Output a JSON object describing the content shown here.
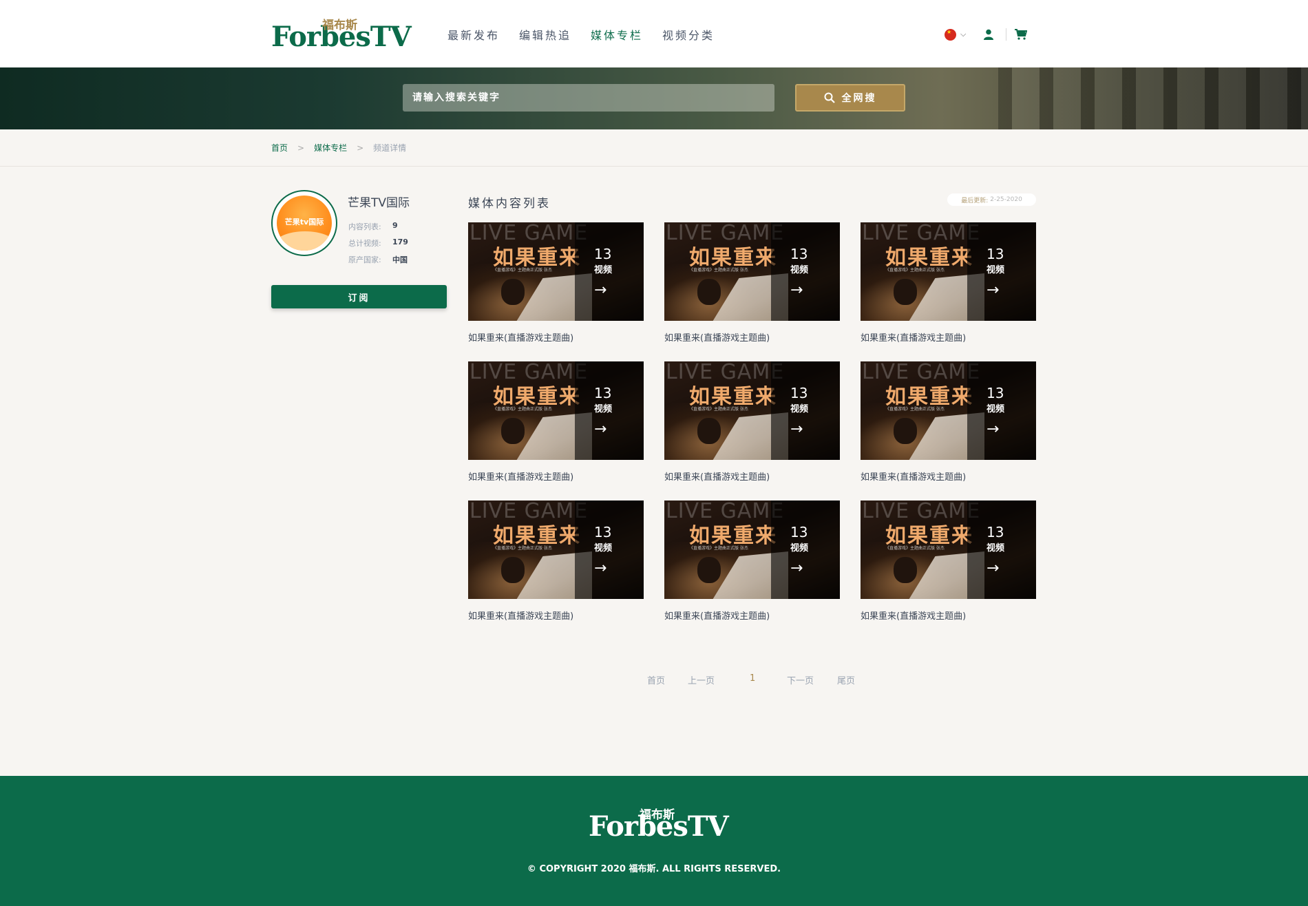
{
  "header": {
    "logo_en": "ForbesTV",
    "logo_cn": "福布斯",
    "nav": [
      {
        "label": "最新发布",
        "active": false
      },
      {
        "label": "编辑热追",
        "active": false
      },
      {
        "label": "媒体专栏",
        "active": true
      },
      {
        "label": "视频分类",
        "active": false
      }
    ],
    "icons": [
      "china-flag-icon",
      "chevron-down-icon",
      "user-icon",
      "cart-icon"
    ]
  },
  "search": {
    "placeholder": "请输入搜索关键字",
    "button_label": "全网搜"
  },
  "breadcrumb": {
    "home": "首页",
    "section": "媒体专栏",
    "current": "频道详情",
    "sep": ">"
  },
  "channel": {
    "name": "芒果TV国际",
    "avatar_text": "芒果tv国际",
    "meta": [
      {
        "key": "内容列表:",
        "value": "9"
      },
      {
        "key": "总计视频:",
        "value": "179"
      },
      {
        "key": "原产国家:",
        "value": "中国"
      }
    ],
    "subscribe_label": "订阅"
  },
  "content": {
    "title": "媒体内容列表",
    "updated_label": "最后更新:",
    "updated_value": "2-25-2020",
    "cards": [
      {
        "title": "如果重来(直播游戏主题曲)",
        "thumb_heading": "如果重来",
        "thumb_bg_text": "LIVE GAME",
        "thumb_sub": "《直播游戏》主题曲正式版   张杰",
        "count": "13",
        "count_label": "视频"
      },
      {
        "title": "如果重来(直播游戏主题曲)",
        "thumb_heading": "如果重来",
        "thumb_bg_text": "LIVE GAME",
        "thumb_sub": "《直播游戏》主题曲正式版   张杰",
        "count": "13",
        "count_label": "视频"
      },
      {
        "title": "如果重来(直播游戏主题曲)",
        "thumb_heading": "如果重来",
        "thumb_bg_text": "LIVE GAME",
        "thumb_sub": "《直播游戏》主题曲正式版   张杰",
        "count": "13",
        "count_label": "视频"
      },
      {
        "title": "如果重来(直播游戏主题曲)",
        "thumb_heading": "如果重来",
        "thumb_bg_text": "LIVE GAME",
        "thumb_sub": "《直播游戏》主题曲正式版   张杰",
        "count": "13",
        "count_label": "视频"
      },
      {
        "title": "如果重来(直播游戏主题曲)",
        "thumb_heading": "如果重来",
        "thumb_bg_text": "LIVE GAME",
        "thumb_sub": "《直播游戏》主题曲正式版   张杰",
        "count": "13",
        "count_label": "视频"
      },
      {
        "title": "如果重来(直播游戏主题曲)",
        "thumb_heading": "如果重来",
        "thumb_bg_text": "LIVE GAME",
        "thumb_sub": "《直播游戏》主题曲正式版   张杰",
        "count": "13",
        "count_label": "视频"
      },
      {
        "title": "如果重来(直播游戏主题曲)",
        "thumb_heading": "如果重来",
        "thumb_bg_text": "LIVE GAME",
        "thumb_sub": "《直播游戏》主题曲正式版   张杰",
        "count": "13",
        "count_label": "视频"
      },
      {
        "title": "如果重来(直播游戏主题曲)",
        "thumb_heading": "如果重来",
        "thumb_bg_text": "LIVE GAME",
        "thumb_sub": "《直播游戏》主题曲正式版   张杰",
        "count": "13",
        "count_label": "视频"
      },
      {
        "title": "如果重来(直播游戏主题曲)",
        "thumb_heading": "如果重来",
        "thumb_bg_text": "LIVE GAME",
        "thumb_sub": "《直播游戏》主题曲正式版   张杰",
        "count": "13",
        "count_label": "视频"
      }
    ]
  },
  "pagination": {
    "first": "首页",
    "prev": "上一页",
    "current": "1",
    "next": "下一页",
    "last": "尾页"
  },
  "footer": {
    "logo_en": "ForbesTV",
    "logo_cn": "福布斯",
    "copyright": "© COPYRIGHT 2020 福布斯. ALL RIGHTS RESERVED."
  },
  "colors": {
    "brand_green": "#0c6b4a",
    "gold": "#a8884c",
    "page_bg": "#f7f5f2"
  }
}
